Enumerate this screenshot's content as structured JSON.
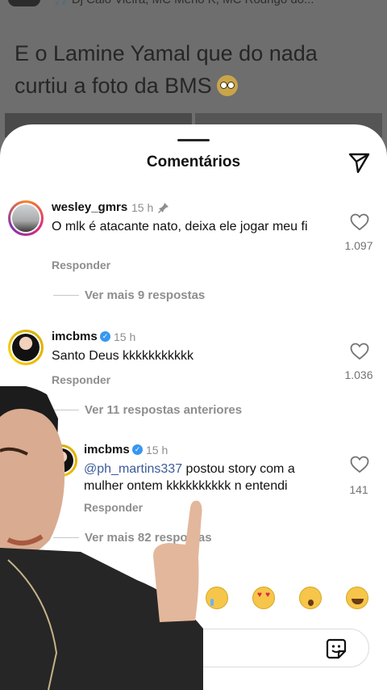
{
  "post": {
    "audio": "🎵 Dj Caio Vieira, MC Menó K, MC Rodrigo do...",
    "caption": "E o Lamine Yamal que do nada curtiu a foto da BMS",
    "caption_emoji": "flushed-face-emoji"
  },
  "sheet": {
    "title": "Comentários"
  },
  "comments": [
    {
      "username": "wesley_gmrs",
      "time": "15 h",
      "pinned": true,
      "text": "O mlk é atacante nato, deixa ele jogar meu fi",
      "reply_label": "Responder",
      "likes": "1.097",
      "more": "Ver mais 9 respostas"
    },
    {
      "username": "imcbms",
      "verified": true,
      "time": "15 h",
      "text": "Santo Deus kkkkkkkkkkk",
      "reply_label": "Responder",
      "likes": "1.036",
      "more": "Ver 11 respostas anteriores"
    },
    {
      "username": "imcbms",
      "verified": true,
      "time": "15 h",
      "mention": "@ph_martins337",
      "text": " postou story com a mulher ontem kkkkkkkkkk n entendi",
      "reply_label": "Responder",
      "likes": "141",
      "more": "Ver mais 82 respostas"
    }
  ],
  "emoji_bar": [
    "crying-face-emoji",
    "heart-eyes-emoji",
    "surprised-face-emoji",
    "laughing-tears-emoji"
  ],
  "input": {
    "value": "",
    "sticker_icon": "sticker-icon"
  },
  "colors": {
    "accent_link": "#3b5a9a",
    "muted_text": "#8e8e8e",
    "verified_blue": "#3897f0"
  }
}
